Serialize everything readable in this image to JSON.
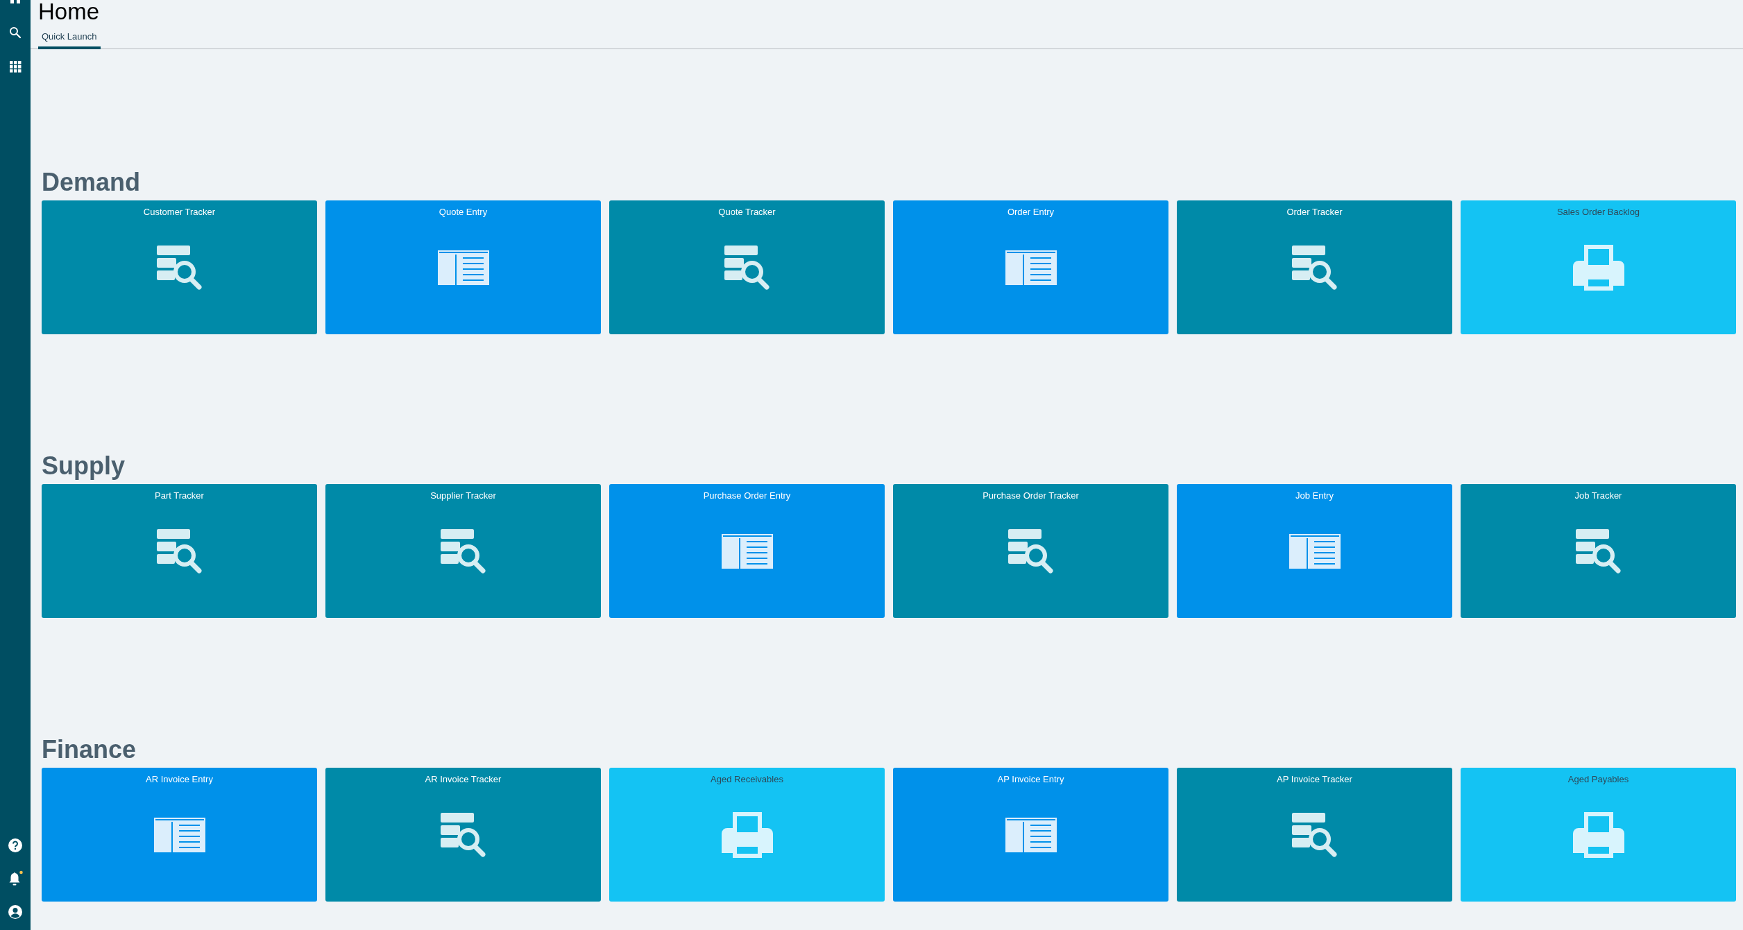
{
  "page": {
    "title": "Home"
  },
  "tabs": [
    {
      "label": "Quick Launch",
      "selected": true
    }
  ],
  "sidebar": {
    "top_items": [
      {
        "kind": "grid-partial"
      },
      {
        "kind": "search"
      },
      {
        "kind": "apps"
      }
    ],
    "bottom_items": [
      {
        "kind": "help"
      },
      {
        "kind": "notifications",
        "unread": true
      },
      {
        "kind": "user"
      }
    ]
  },
  "sections": [
    {
      "title": "Demand",
      "tiles": [
        {
          "label": "Customer Tracker",
          "kind": "tracker"
        },
        {
          "label": "Quote Entry",
          "kind": "entry"
        },
        {
          "label": "Quote Tracker",
          "kind": "tracker"
        },
        {
          "label": "Order Entry",
          "kind": "entry"
        },
        {
          "label": "Order Tracker",
          "kind": "tracker"
        },
        {
          "label": "Sales Order Backlog",
          "kind": "report"
        }
      ]
    },
    {
      "title": "Supply",
      "tiles": [
        {
          "label": "Part Tracker",
          "kind": "tracker"
        },
        {
          "label": "Supplier Tracker",
          "kind": "tracker"
        },
        {
          "label": "Purchase Order Entry",
          "kind": "entry"
        },
        {
          "label": "Purchase Order Tracker",
          "kind": "tracker"
        },
        {
          "label": "Job Entry",
          "kind": "entry"
        },
        {
          "label": "Job Tracker",
          "kind": "tracker"
        }
      ]
    },
    {
      "title": "Finance",
      "tiles": [
        {
          "label": "AR Invoice Entry",
          "kind": "entry"
        },
        {
          "label": "AR Invoice Tracker",
          "kind": "tracker"
        },
        {
          "label": "Aged Receivables",
          "kind": "report"
        },
        {
          "label": "AP Invoice Entry",
          "kind": "entry"
        },
        {
          "label": "AP Invoice Tracker",
          "kind": "tracker"
        },
        {
          "label": "Aged Payables",
          "kind": "report"
        }
      ]
    }
  ]
}
